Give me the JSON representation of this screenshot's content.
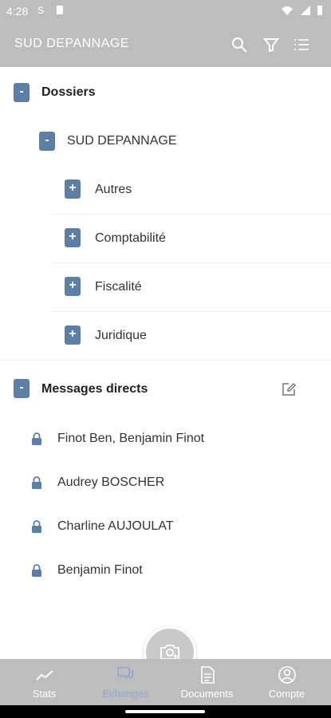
{
  "status_bar": {
    "time": "4:28"
  },
  "app_bar": {
    "title": "SUD DEPANNAGE",
    "icons": [
      "search-icon",
      "filter-icon",
      "list-icon"
    ]
  },
  "dossiers": {
    "toggle": "-",
    "title": "Dossiers",
    "company": {
      "toggle": "-",
      "name": "SUD DEPANNAGE"
    },
    "folders": [
      {
        "toggle": "+",
        "name": "Autres"
      },
      {
        "toggle": "+",
        "name": "Comptabilité"
      },
      {
        "toggle": "+",
        "name": "Fiscalité"
      },
      {
        "toggle": "+",
        "name": "Juridique"
      }
    ]
  },
  "messages": {
    "toggle": "-",
    "title": "Messages directs",
    "items": [
      {
        "name": "Finot Ben, Benjamin Finot"
      },
      {
        "name": "Audrey BOSCHER"
      },
      {
        "name": "Charline AUJOULAT"
      },
      {
        "name": "Benjamin Finot"
      }
    ]
  },
  "bottom_nav": {
    "active": "Echanges",
    "items": [
      {
        "label": "Stats",
        "icon": "stats-icon"
      },
      {
        "label": "Echanges",
        "icon": "chat-icon"
      },
      {
        "label": "Documents",
        "icon": "document-icon"
      },
      {
        "label": "Compte",
        "icon": "account-icon"
      }
    ]
  },
  "colors": {
    "bars": "#bdbdbd",
    "toggle": "#5b7fa6",
    "active_nav": "#8ea9cf"
  }
}
